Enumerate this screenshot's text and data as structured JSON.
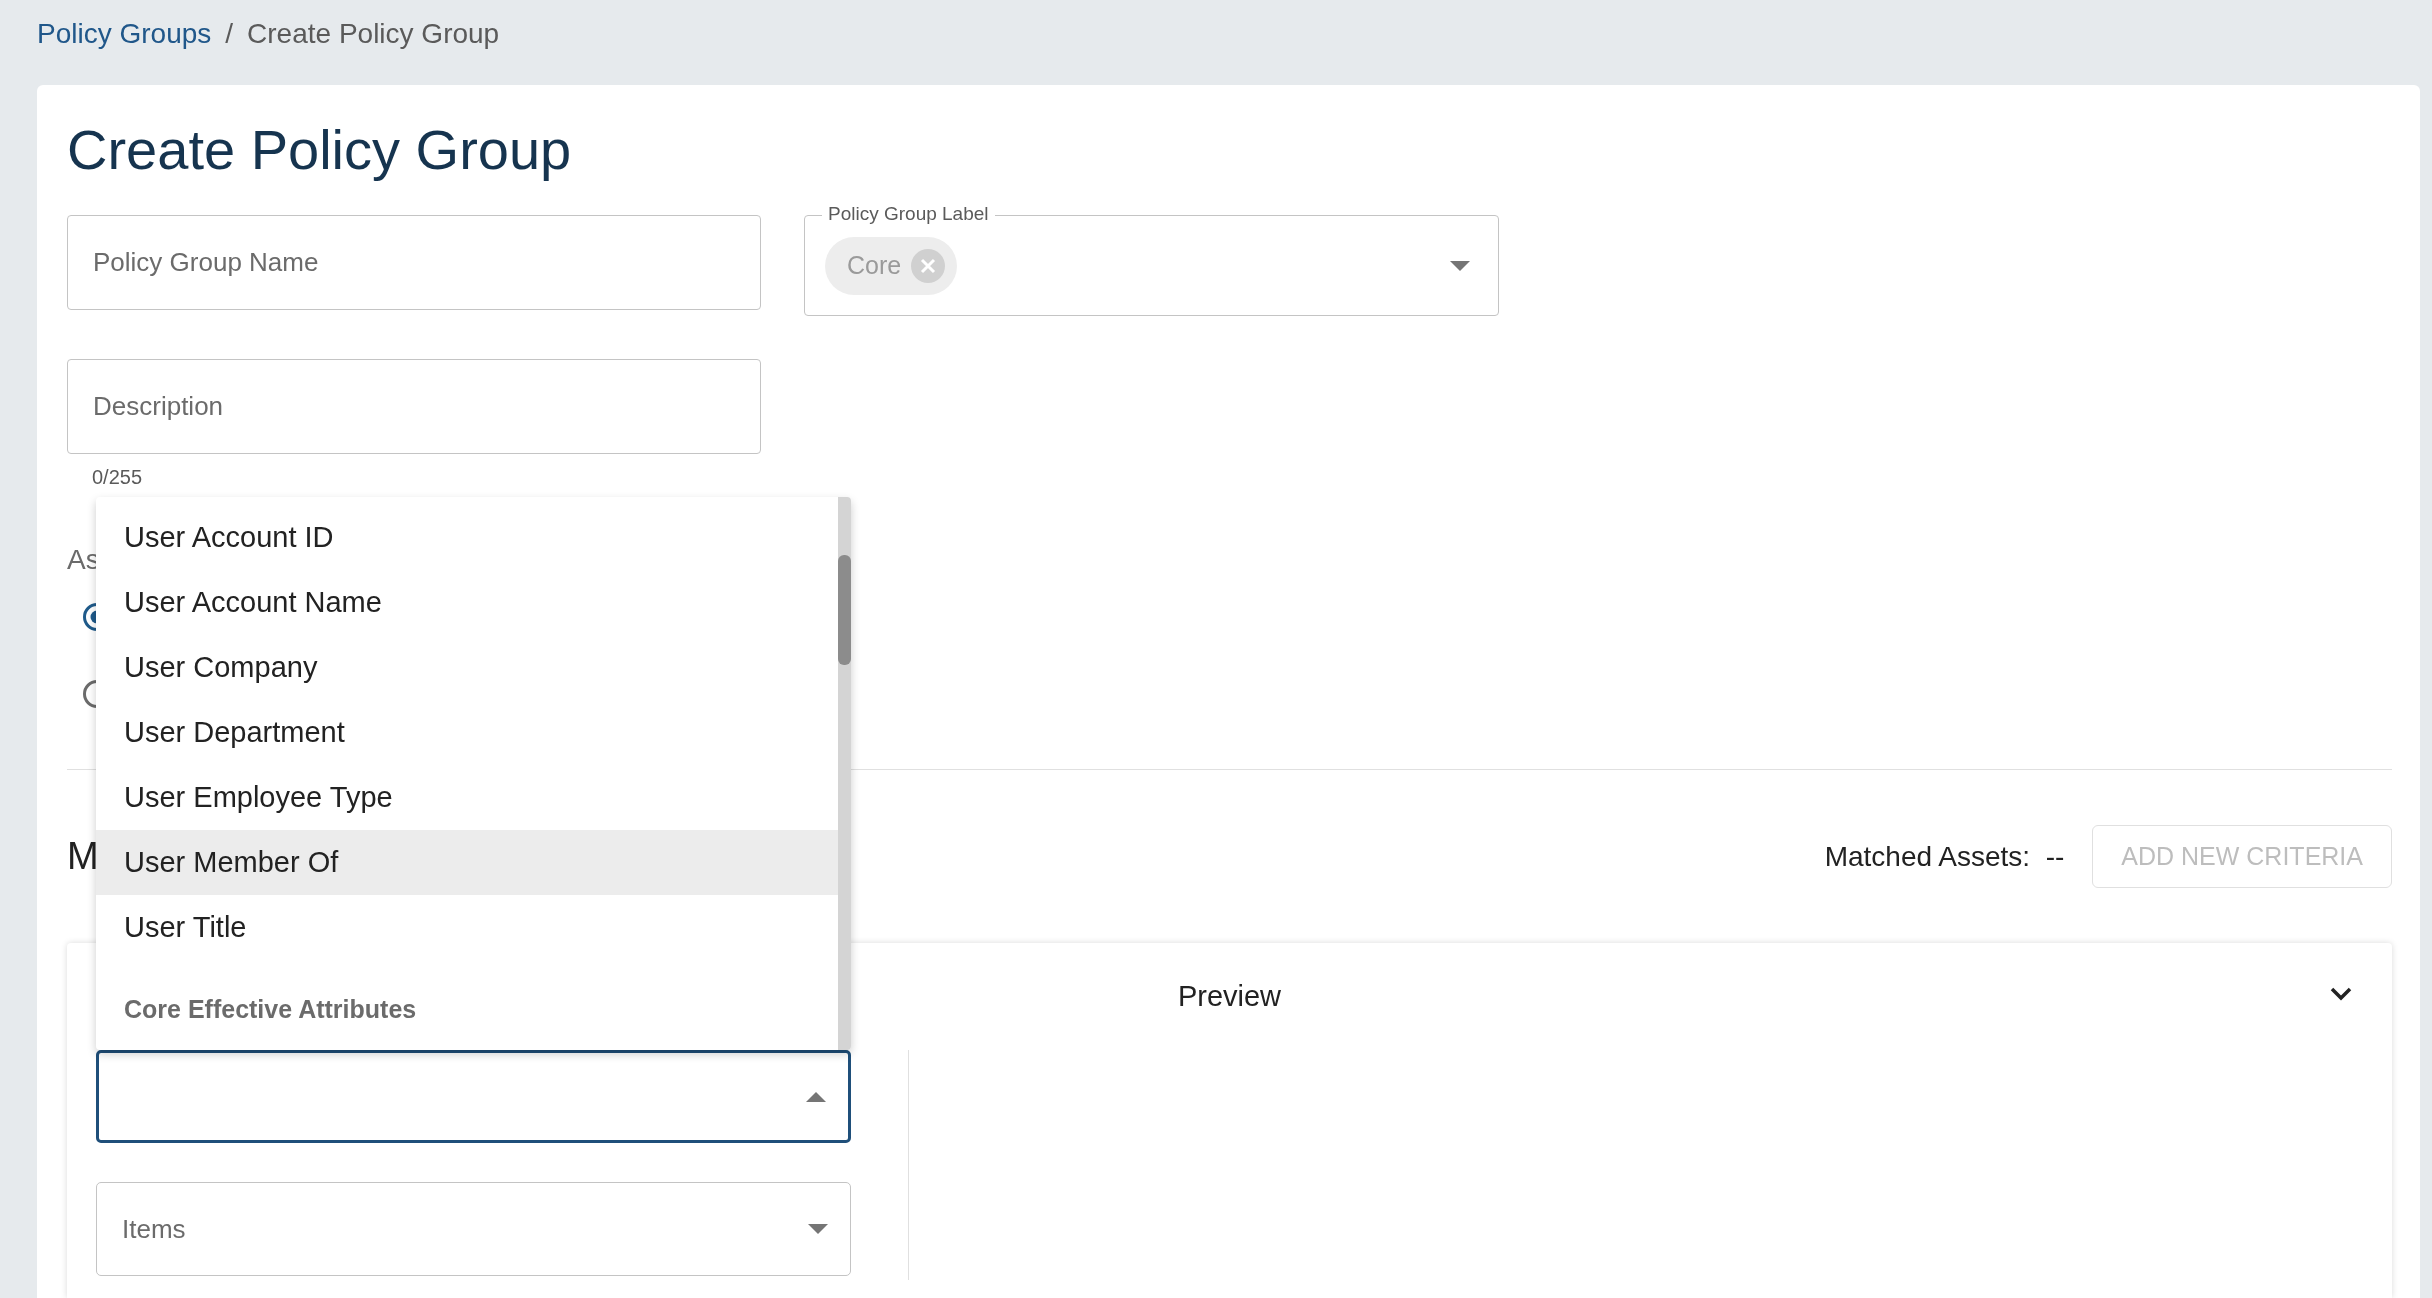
{
  "breadcrumb": [
    {
      "label": "Policy Groups",
      "kind": "link"
    },
    {
      "label": "Create Policy Group",
      "kind": "current"
    }
  ],
  "breadcrumb_separator": "/",
  "title": "Create Policy Group",
  "name_field": {
    "placeholder": "Policy Group Name"
  },
  "label_field": {
    "label": "Policy Group Label",
    "chips": [
      {
        "label": "Core"
      }
    ]
  },
  "description_field": {
    "placeholder": "Description",
    "counter": "0/255"
  },
  "assignment": {
    "label": "As",
    "options": [
      {
        "selected": true
      },
      {
        "selected": false
      }
    ]
  },
  "criteria_section": {
    "heading": "M",
    "matched_label": "Matched Assets:",
    "matched_value": "--",
    "add_button": {
      "label": "ADD NEW CRITERIA",
      "disabled": true
    }
  },
  "preview": {
    "title": "Preview"
  },
  "criteria_field": {
    "open": true
  },
  "items_field": {
    "placeholder": "Items"
  },
  "menu": {
    "items": [
      {
        "kind": "option",
        "label": "User Account ID",
        "selected": false
      },
      {
        "kind": "option",
        "label": "User Account Name",
        "selected": false
      },
      {
        "kind": "option",
        "label": "User Company",
        "selected": false
      },
      {
        "kind": "option",
        "label": "User Department",
        "selected": false
      },
      {
        "kind": "option",
        "label": "User Employee Type",
        "selected": false
      },
      {
        "kind": "option",
        "label": "User Member Of",
        "selected": true
      },
      {
        "kind": "option",
        "label": "User Title",
        "selected": false
      },
      {
        "kind": "header",
        "label": "Core Effective Attributes"
      }
    ]
  }
}
